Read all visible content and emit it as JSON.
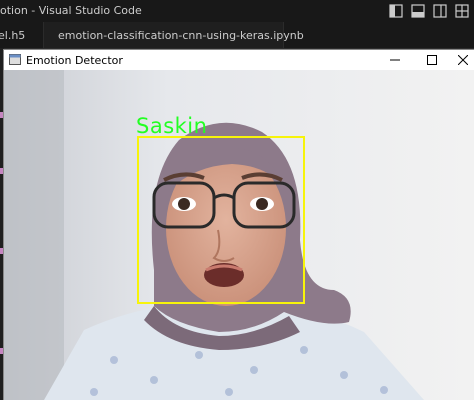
{
  "vscode": {
    "title": "otion - Visual Studio Code",
    "tabs": [
      {
        "label": "el.h5"
      },
      {
        "label": "emotion-classification-cnn-using-keras.ipynb"
      }
    ]
  },
  "window": {
    "title": "Emotion Detector",
    "controls": [
      "minimize",
      "maximize",
      "close"
    ]
  },
  "detection": {
    "label": "Saskin",
    "label_color": "#22ff22",
    "box_color": "#f7f40a"
  },
  "colors": {
    "vscode_bg": "#181818",
    "accent_tab_icon": "#519aba"
  }
}
